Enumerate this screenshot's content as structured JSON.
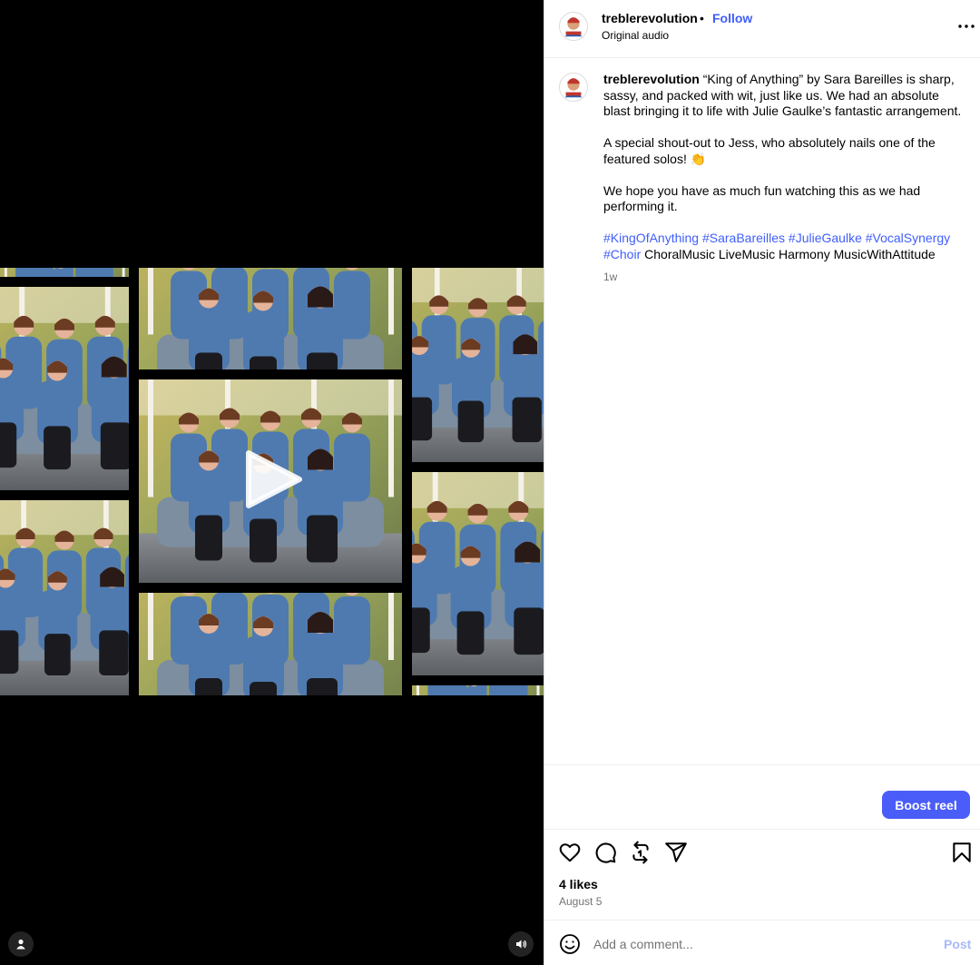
{
  "header": {
    "username": "treblerevolution",
    "separator": "•",
    "follow_label": "Follow",
    "audio_label": "Original audio"
  },
  "caption": {
    "username": "treblerevolution",
    "para1": "“King of Anything” by Sara Bareilles is sharp, sassy, and packed with wit, just like us. We had an absolute blast bringing it to life with Julie Gaulke’s fantastic arrangement.",
    "para2": "A special shout-out to Jess, who absolutely nails one of the featured solos! 👏",
    "para3": "We hope you have as much fun watching this as we had performing it.",
    "hashtags": [
      "#KingOfAnything",
      "#SaraBareilles",
      "#JulieGaulke",
      "#VocalSynergy",
      "#Choir"
    ],
    "plain_tags": "ChoralMusic LiveMusic Harmony MusicWithAttitude",
    "time_ago": "1w"
  },
  "boost": {
    "label": "Boost reel"
  },
  "actions": {
    "like_icon": "heart-icon",
    "comment_icon": "comment-icon",
    "repost_icon": "repost-icon",
    "share_icon": "send-icon",
    "save_icon": "bookmark-icon"
  },
  "stats": {
    "likes": "4 likes",
    "date": "August 5"
  },
  "comment_box": {
    "placeholder": "Add a comment...",
    "post_label": "Post",
    "emoji_icon": "emoji-icon"
  },
  "video": {
    "play_icon": "play-icon",
    "user_tag_icon": "user-tag-icon",
    "sound_icon": "volume-icon"
  },
  "colors": {
    "accent": "#3f5efb",
    "boost_button": "#4a5df9",
    "muted_text": "#737373",
    "post_disabled": "#a9b8f8"
  }
}
